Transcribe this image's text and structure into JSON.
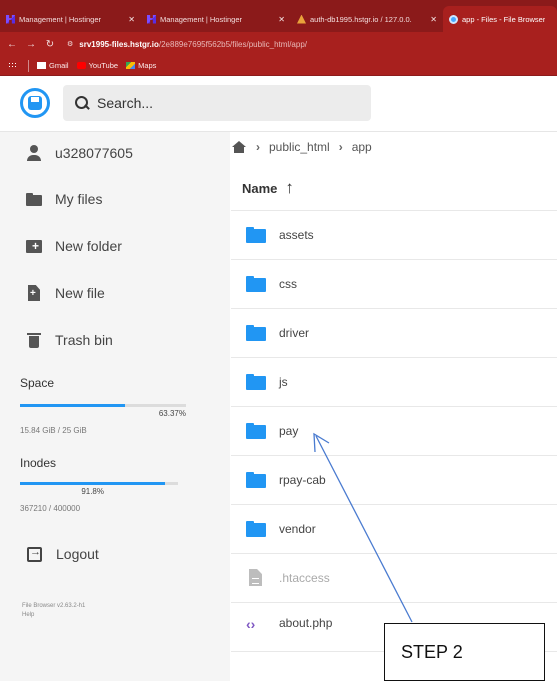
{
  "browser": {
    "tabs": [
      {
        "label": "Management | Hostinger",
        "icon": "hostinger-icon",
        "active": false
      },
      {
        "label": "Management | Hostinger",
        "icon": "hostinger-icon",
        "active": false
      },
      {
        "label": "auth-db1995.hstgr.io / 127.0.0.",
        "icon": "phpmyadmin-icon",
        "active": false
      },
      {
        "label": "app - Files - File Browser",
        "icon": "filebrowser-icon",
        "active": true
      }
    ],
    "url_host": "srv1995-files.hstgr.io",
    "url_path": "/2e889e7695f562b5/files/public_html/app/",
    "bookmarks": [
      "Gmail",
      "YouTube",
      "Maps"
    ]
  },
  "header": {
    "search_placeholder": "Search..."
  },
  "sidebar": {
    "user": "u328077605",
    "items": [
      {
        "label": "My files"
      },
      {
        "label": "New folder"
      },
      {
        "label": "New file"
      },
      {
        "label": "Trash bin"
      }
    ],
    "space": {
      "label": "Space",
      "percent_text": "63.37%",
      "fraction": 0.6337,
      "detail": "15.84 GiB / 25 GiB"
    },
    "inodes": {
      "label": "Inodes",
      "percent_text": "91.8%",
      "fraction": 0.918,
      "detail": "367210 / 400000"
    },
    "logout_label": "Logout",
    "footer_version": "File Browser v2.63.2-h1",
    "footer_help": "Help"
  },
  "main": {
    "breadcrumb": [
      "public_html",
      "app"
    ],
    "name_header": "Name",
    "files": [
      {
        "name": "assets",
        "type": "folder"
      },
      {
        "name": "css",
        "type": "folder"
      },
      {
        "name": "driver",
        "type": "folder"
      },
      {
        "name": "js",
        "type": "folder"
      },
      {
        "name": "pay",
        "type": "folder"
      },
      {
        "name": "rpay-cab",
        "type": "folder"
      },
      {
        "name": "vendor",
        "type": "folder"
      },
      {
        "name": ".htaccess",
        "type": "file"
      },
      {
        "name": "about.php",
        "type": "code"
      }
    ]
  },
  "annotation": {
    "label": "STEP 2",
    "color": "#4a7bd0"
  }
}
